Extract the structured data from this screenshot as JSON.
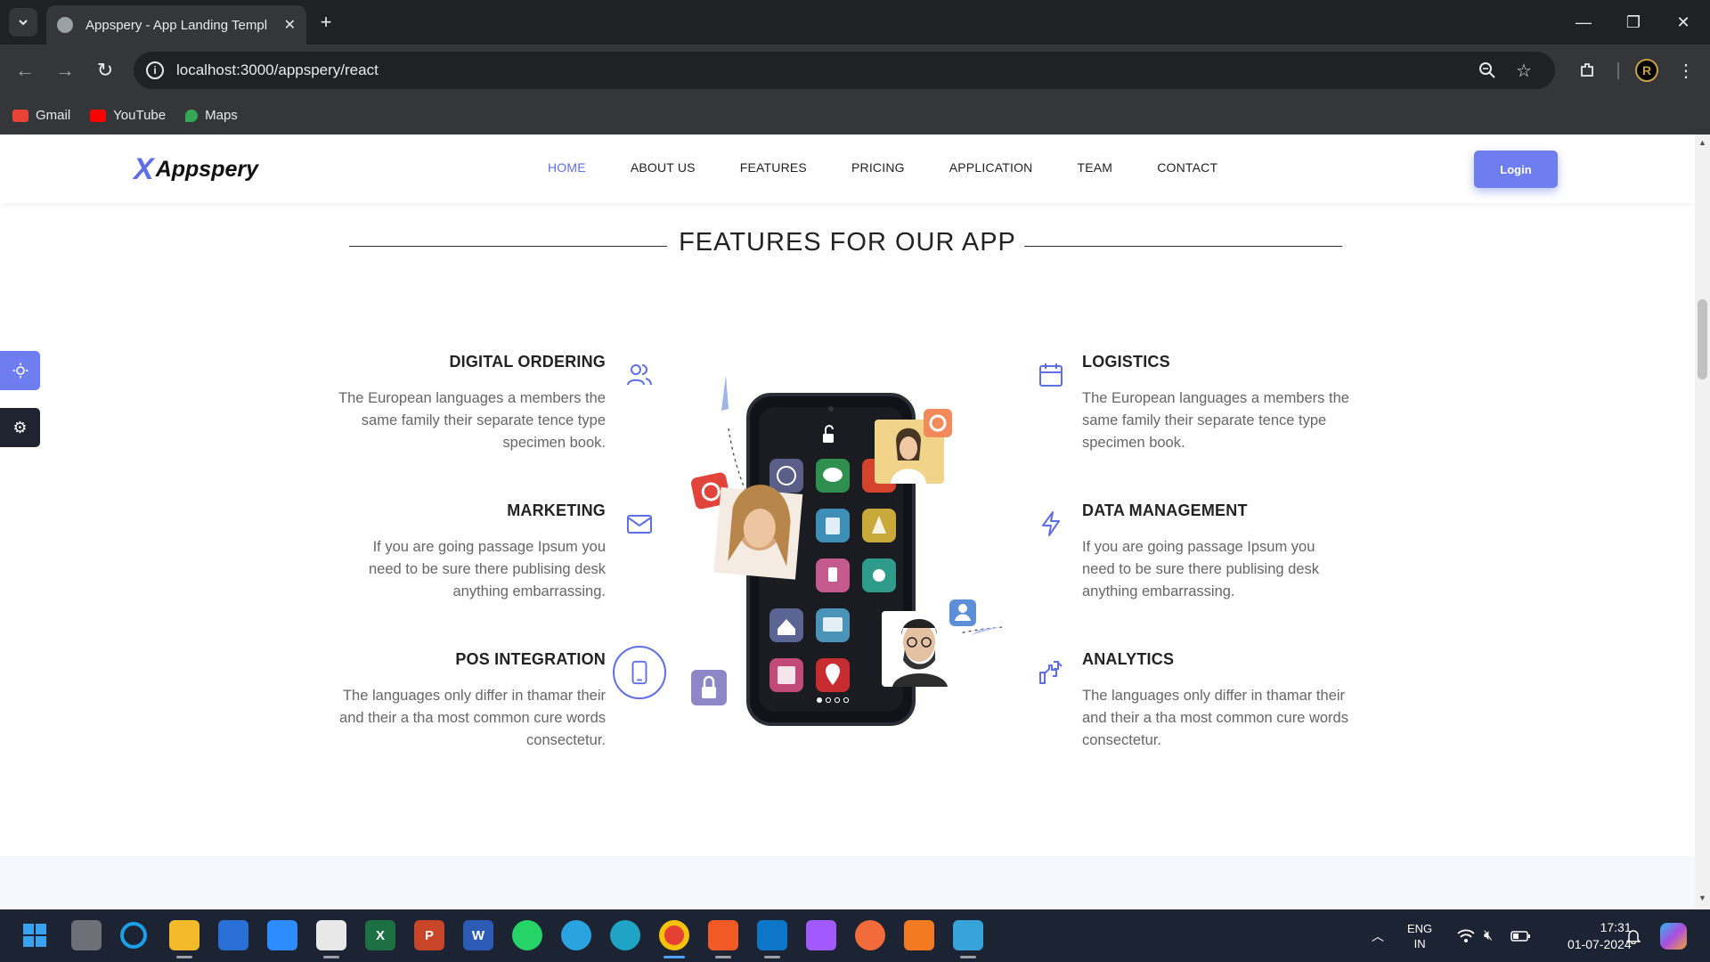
{
  "browser": {
    "tab_title": "Appspery - App Landing Templ",
    "url": "localhost:3000/appspery/react",
    "bookmarks": [
      {
        "label": "Gmail",
        "color": "#ea4335"
      },
      {
        "label": "YouTube",
        "color": "#ff0000"
      },
      {
        "label": "Maps",
        "color": "#34a853"
      }
    ]
  },
  "site": {
    "logo_mark": "X",
    "logo_text": "Appspery",
    "nav": [
      "HOME",
      "ABOUT US",
      "FEATURES",
      "PRICING",
      "APPLICATION",
      "TEAM",
      "CONTACT"
    ],
    "active_nav": "HOME",
    "login_label": "Login"
  },
  "section": {
    "title": "FEATURES FOR OUR APP",
    "left_features": [
      {
        "title": "DIGITAL ORDERING",
        "text": "The European languages a members the same family their separate tence type specimen book.",
        "icon": "users-icon"
      },
      {
        "title": "MARKETING",
        "text": "If you are going passage Ipsum you need to be sure there publising desk anything embarrassing.",
        "icon": "mail-icon"
      },
      {
        "title": "POS INTEGRATION",
        "text": "The languages only differ in thamar their and their a tha most common cure words consectetur.",
        "icon": "tablet-icon"
      }
    ],
    "right_features": [
      {
        "title": "LOGISTICS",
        "text": "The European languages a members the same family their separate tence type specimen book.",
        "icon": "calendar-icon"
      },
      {
        "title": "DATA MANAGEMENT",
        "text": "If you are going passage Ipsum you need to be sure there publising desk anything embarrassing.",
        "icon": "lightning-icon"
      },
      {
        "title": "ANALYTICS",
        "text": "The languages only differ in thamar their and their a tha most common cure words consectetur.",
        "icon": "thumbs-icon"
      }
    ]
  },
  "colors": {
    "accent": "#5d6ee8",
    "login_bg": "#6e7ef0",
    "taskbar": "#1c2433"
  },
  "taskbar": {
    "lang_top": "ENG",
    "lang_bottom": "IN",
    "time": "17:31",
    "date": "01-07-2024"
  }
}
